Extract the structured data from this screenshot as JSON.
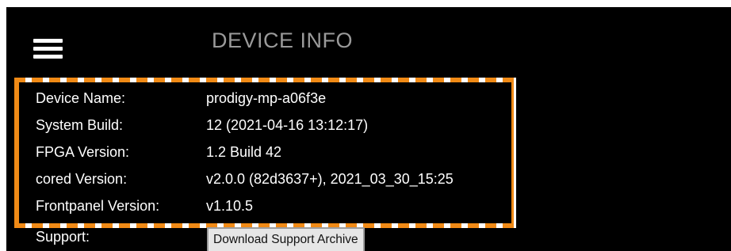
{
  "header": {
    "menu_icon": "hamburger-menu-icon",
    "title": "DEVICE INFO"
  },
  "device_info": {
    "rows": [
      {
        "label": "Device Name:",
        "value": "prodigy-mp-a06f3e"
      },
      {
        "label": "System Build:",
        "value": "12 (2021-04-16 13:12:17)"
      },
      {
        "label": "FPGA Version:",
        "value": "1.2 Build 42"
      },
      {
        "label": "cored Version:",
        "value": "v2.0.0 (82d3637+), 2021_03_30_15:25"
      },
      {
        "label": "Frontpanel Version:",
        "value": "v1.10.5"
      }
    ]
  },
  "support": {
    "label": "Support:",
    "button_label": "Download Support Archive"
  },
  "colors": {
    "background": "#000000",
    "title": "#9a9a9a",
    "text": "#ffffff",
    "highlight_dash_primary": "#f08a16",
    "highlight_dash_secondary": "#ffffff",
    "button_background": "#e6e6e6"
  }
}
